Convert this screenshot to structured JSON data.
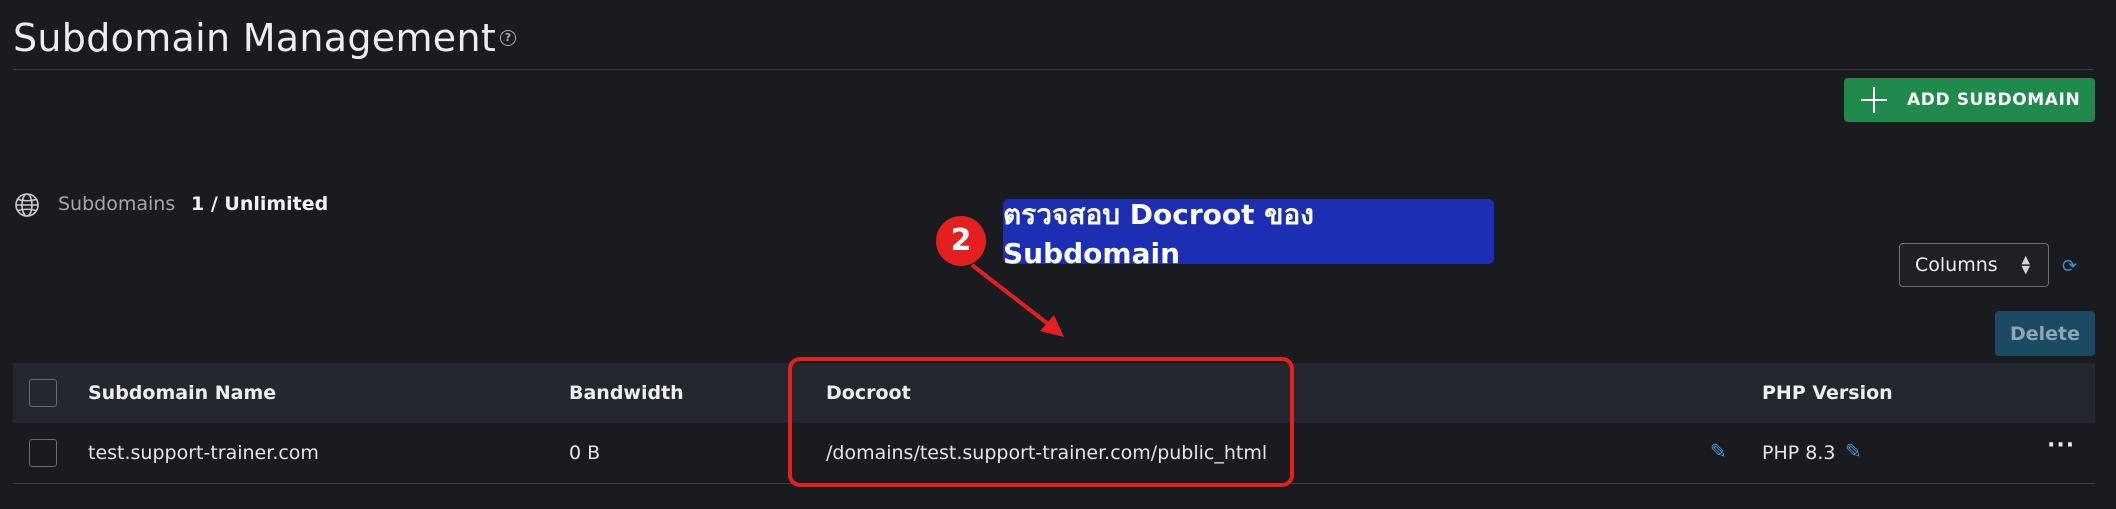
{
  "header": {
    "title": "Subdomain Management",
    "help_icon": "?"
  },
  "toolbar": {
    "add_label": "ADD SUBDOMAIN",
    "columns_label": "Columns",
    "delete_label": "Delete"
  },
  "summary": {
    "label": "Subdomains",
    "count": "1 / Unlimited"
  },
  "annotation": {
    "number": "2",
    "text": "ตรวจสอบ Docroot ของ Subdomain"
  },
  "table": {
    "columns": [
      "Subdomain Name",
      "Bandwidth",
      "Docroot",
      "PHP Version"
    ],
    "rows": [
      {
        "name": "test.support-trainer.com",
        "bandwidth": "0 B",
        "docroot": "/domains/test.support-trainer.com/public_html",
        "php": "PHP 8.3"
      }
    ]
  },
  "colors": {
    "add_button": "#1f8a4c",
    "callout": "#1c2fb4",
    "highlight": "#e31f1f",
    "edit_icon": "#3f8fd4"
  }
}
